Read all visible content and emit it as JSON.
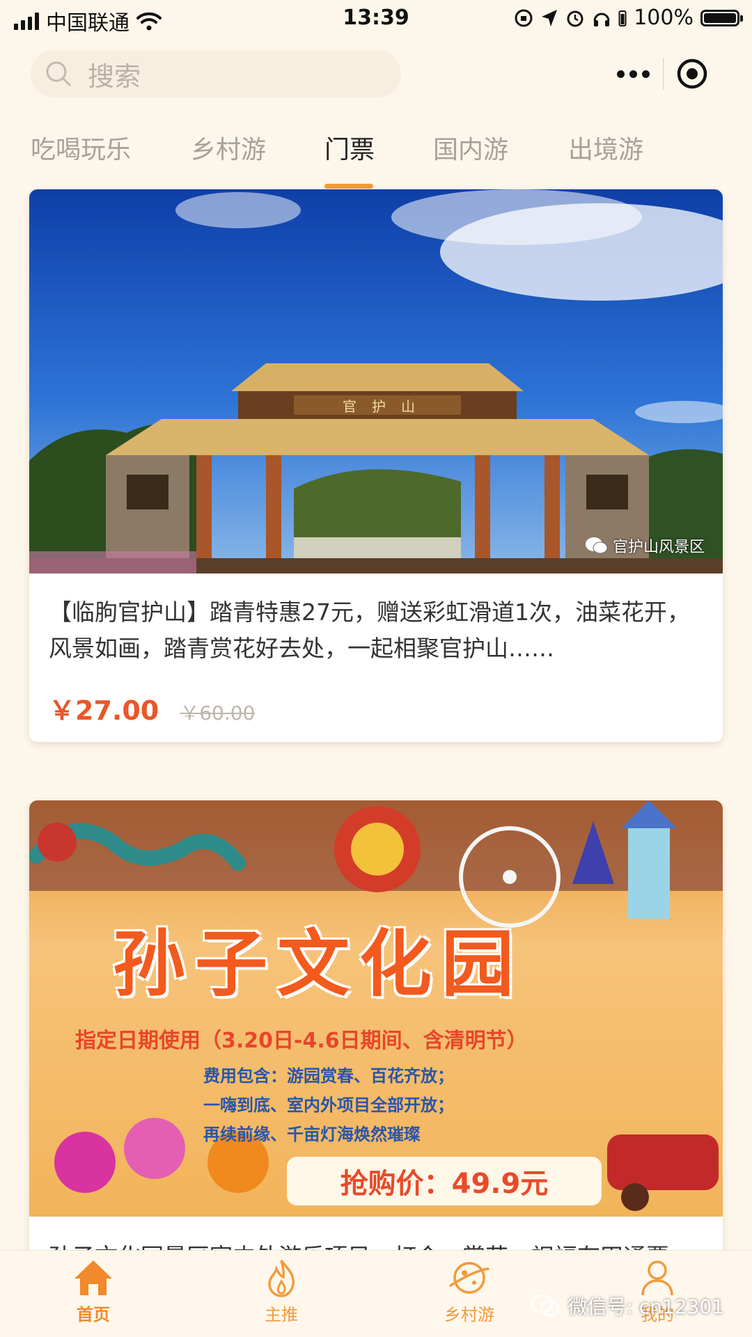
{
  "status_bar": {
    "carrier": "中国联通",
    "time": "13:39",
    "battery_text": "100%",
    "battery_level": 1.0
  },
  "search": {
    "placeholder": "搜索",
    "icon": "search-icon"
  },
  "tabs": [
    {
      "label": "吃喝玩乐",
      "active": false
    },
    {
      "label": "乡村游",
      "active": false
    },
    {
      "label": "门票",
      "active": true
    },
    {
      "label": "国内游",
      "active": false
    },
    {
      "label": "出境游",
      "active": false
    }
  ],
  "cards": [
    {
      "image_caption": "官护山",
      "image_watermark": "官护山风景区",
      "title": "【临朐官护山】踏青特惠27元，赠送彩虹滑道1次，油菜花开，风景如画，踏青赏花好去处，一起相聚官护山……",
      "price": "￥27.00",
      "original_price": "￥60.00"
    },
    {
      "poster": {
        "headline": "孙子文化园",
        "subtitle": "指定日期使用（3.20日-4.6日期间、含清明节）",
        "line1": "费用包含：游园赏春、百花齐放；",
        "line2": "一嗨到底、室内外项目全部开放；",
        "line3": "再续前缘、千亩灯海焕然璀璨",
        "deal": "抢购价：49.9元"
      },
      "title": "孙子文化园景区室内外游乐项目、灯会、赏花、祝福有田通票"
    }
  ],
  "bottom_nav": [
    {
      "label": "首页",
      "icon": "home-icon",
      "active": true
    },
    {
      "label": "主推",
      "icon": "flame-icon",
      "active": false
    },
    {
      "label": "乡村游",
      "icon": "planet-icon",
      "active": false
    },
    {
      "label": "我的",
      "icon": "user-icon",
      "active": false
    }
  ],
  "watermark": "微信号: cn12301",
  "colors": {
    "background": "#fdf6ea",
    "accent": "#f39a3a",
    "price": "#e8572a",
    "nav": "#f19b3c"
  }
}
